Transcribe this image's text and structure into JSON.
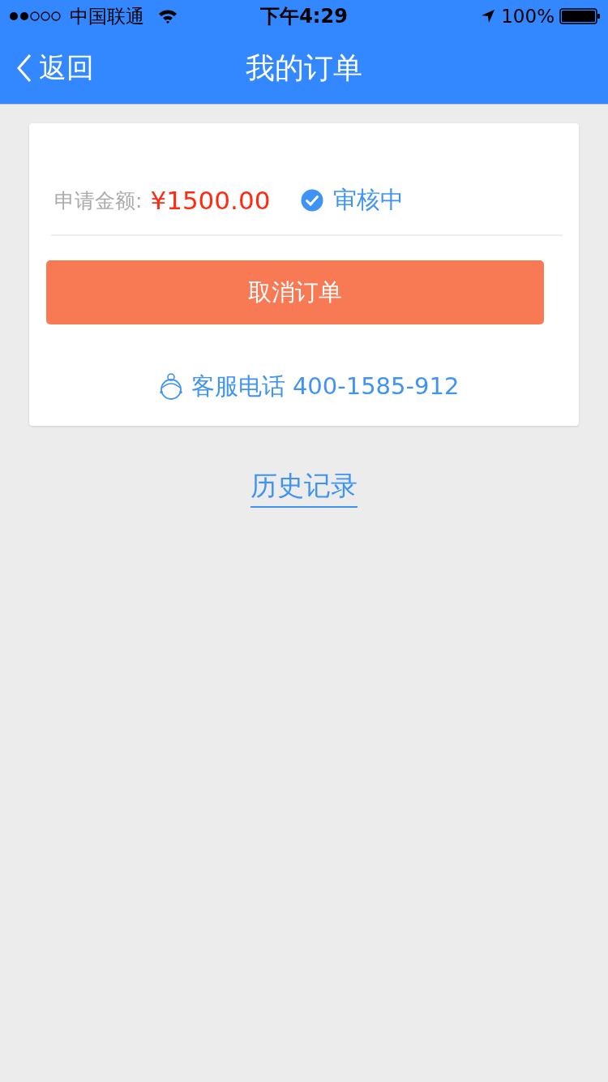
{
  "status_bar": {
    "carrier": "中国联通",
    "time": "下午4:29",
    "battery": "100%"
  },
  "nav": {
    "back": "返回",
    "title": "我的订单"
  },
  "order": {
    "amount_label": "申请金额:",
    "amount": "¥1500.00",
    "status": "审核中",
    "cancel_button": "取消订单",
    "service_phone": "客服电话 400-1585-912"
  },
  "history_link": "历史记录"
}
